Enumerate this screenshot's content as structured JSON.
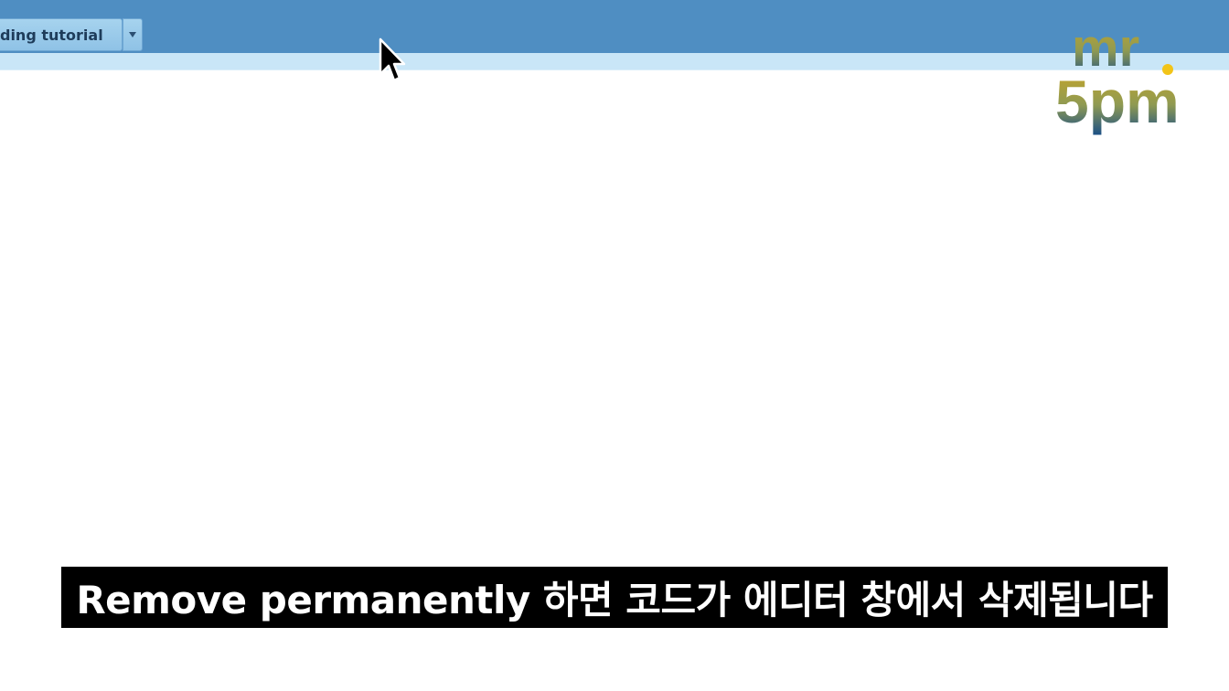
{
  "toolbar": {
    "project_label": "oding tutorial",
    "dropdown_icon": "caret-down-icon",
    "colors": {
      "toolbar_bg": "#4f8ec2",
      "strip_bg": "#c9e6f7"
    }
  },
  "cursor": {
    "icon": "mouse-pointer-icon"
  },
  "logo": {
    "line1": "mr",
    "line2": "5pm",
    "colors": {
      "gold": "#c9a626",
      "navy": "#1a4f86",
      "dot": "#f2c418"
    }
  },
  "caption": {
    "text": "Remove permanently 하면 코드가 에디터 창에서 삭제됩니다"
  }
}
